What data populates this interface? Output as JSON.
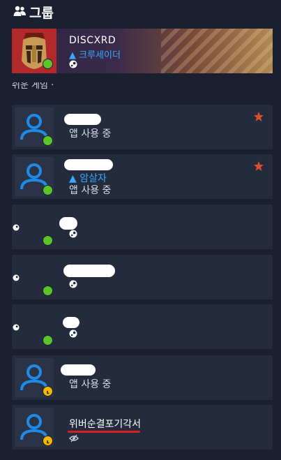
{
  "header": {
    "title": "그룹",
    "icon": "group-icon"
  },
  "featured": {
    "name": "DISCXRD",
    "subtitle": "▲ 크루세이더",
    "status": "online",
    "icon": "steam-icon"
  },
  "cut_text": "쉬운 게임 ·",
  "cut_dash": "-",
  "friends": [
    {
      "activity": "앱 사용 중",
      "status": "online",
      "starred": true
    },
    {
      "rank": "▲ 암살자",
      "activity": "앱 사용 중",
      "status": "online",
      "starred": true
    },
    {
      "status": "online",
      "icon": "steam-icon"
    },
    {
      "status": "online",
      "icon": "steam-icon"
    },
    {
      "status": "online",
      "icon": "steam-icon"
    },
    {
      "activity": "앱 사용 중",
      "status": "away"
    },
    {
      "name": "위버순결포기각서",
      "status": "away",
      "icon": "eye-slash-icon"
    }
  ],
  "colors": {
    "background": "#1a2030",
    "card": "#232b3c",
    "online": "#5bc42a",
    "away": "#f5b800",
    "star": "#d8502a",
    "rank": "#3aa7ff",
    "avatar_placeholder": "#1e8be8",
    "underline": "#d62020"
  }
}
